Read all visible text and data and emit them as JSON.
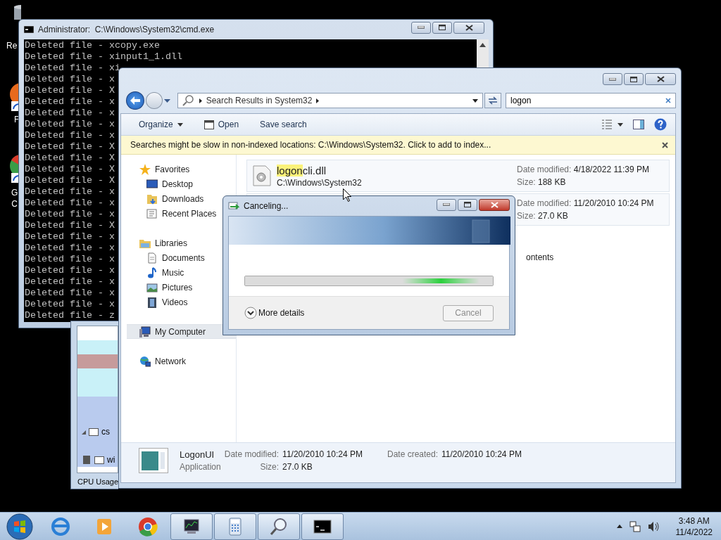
{
  "desktop_icons": [
    {
      "lines": [
        "Re"
      ]
    },
    {
      "lines": [
        "F"
      ]
    },
    {
      "lines": [
        "G",
        "C"
      ]
    }
  ],
  "cmd": {
    "title": "Administrator:  C:\\Windows\\System32\\cmd.exe",
    "lines": [
      "Deleted file - xcopy.exe",
      "Deleted file - xinput1_1.dll",
      "Deleted file - xi",
      "Deleted file - x",
      "Deleted file - X",
      "Deleted file - x",
      "Deleted file - x",
      "Deleted file - x",
      "Deleted file - x",
      "Deleted file - X",
      "Deleted file - X",
      "Deleted file - X",
      "Deleted file - X",
      "Deleted file - x",
      "Deleted file - x",
      "Deleted file - x",
      "Deleted file - X",
      "Deleted file - x",
      "Deleted file - x",
      "Deleted file - x",
      "Deleted file - x",
      "Deleted file - x",
      "Deleted file - x",
      "Deleted file - x",
      "Deleted file - z"
    ]
  },
  "task_manager": {
    "rows": [
      {
        "label": "cs"
      },
      {
        "label": "wi"
      }
    ],
    "status": "CPU Usage"
  },
  "explorer": {
    "address": {
      "crumb": "Search Results in System32"
    },
    "search": {
      "value": "logon"
    },
    "toolbar": [
      {
        "label": "Organize",
        "kind": "menu"
      },
      {
        "label": "Open",
        "kind": "icon"
      },
      {
        "label": "Save search",
        "kind": "plain"
      }
    ],
    "info_bar": "Searches might be slow in non-indexed locations: C:\\Windows\\System32. Click to add to index...",
    "nav": [
      {
        "label": "Favorites",
        "selected": false,
        "children": [
          {
            "label": "Desktop",
            "selected": false
          },
          {
            "label": "Downloads",
            "selected": false
          },
          {
            "label": "Recent Places",
            "selected": false
          }
        ]
      },
      {
        "label": "Libraries",
        "selected": false,
        "children": [
          {
            "label": "Documents",
            "selected": false
          },
          {
            "label": "Music",
            "selected": false
          },
          {
            "label": "Pictures",
            "selected": false
          },
          {
            "label": "Videos",
            "selected": false
          }
        ]
      },
      {
        "label": "My Computer",
        "selected": true
      },
      {
        "label": "Network",
        "selected": false
      }
    ],
    "results": [
      {
        "match": "logon",
        "rest": "cli.dll",
        "path": "C:\\Windows\\System32",
        "modified_label": "Date modified:",
        "modified": "4/18/2022 11:39 PM",
        "size_label": "Size:",
        "size": "188 KB"
      },
      {
        "modified_label": "Date modified:",
        "modified": "11/20/2010 10:24 PM",
        "size_label": "Size:",
        "size": "27.0 KB"
      }
    ],
    "search_again": "ontents",
    "details": {
      "name": "LogonUI",
      "type": "Application",
      "fields": [
        {
          "label": "Date modified:",
          "value": "11/20/2010 10:24 PM"
        },
        {
          "label": "Size:",
          "value": "27.0 KB"
        },
        {
          "label": "Date created:",
          "value": "11/20/2010 10:24 PM"
        }
      ]
    }
  },
  "dialog": {
    "title": "Canceling...",
    "progress": {
      "indeterminate": true
    },
    "more": "More details",
    "cancel": {
      "label": "Cancel",
      "disabled": true
    }
  },
  "taskbar": {
    "buttons": [
      {
        "open": false
      },
      {
        "open": false
      },
      {
        "open": false
      },
      {
        "open": true
      },
      {
        "open": true
      },
      {
        "open": true
      },
      {
        "open": true
      }
    ],
    "clock": {
      "time": "3:48 AM",
      "date": "11/4/2022"
    }
  }
}
